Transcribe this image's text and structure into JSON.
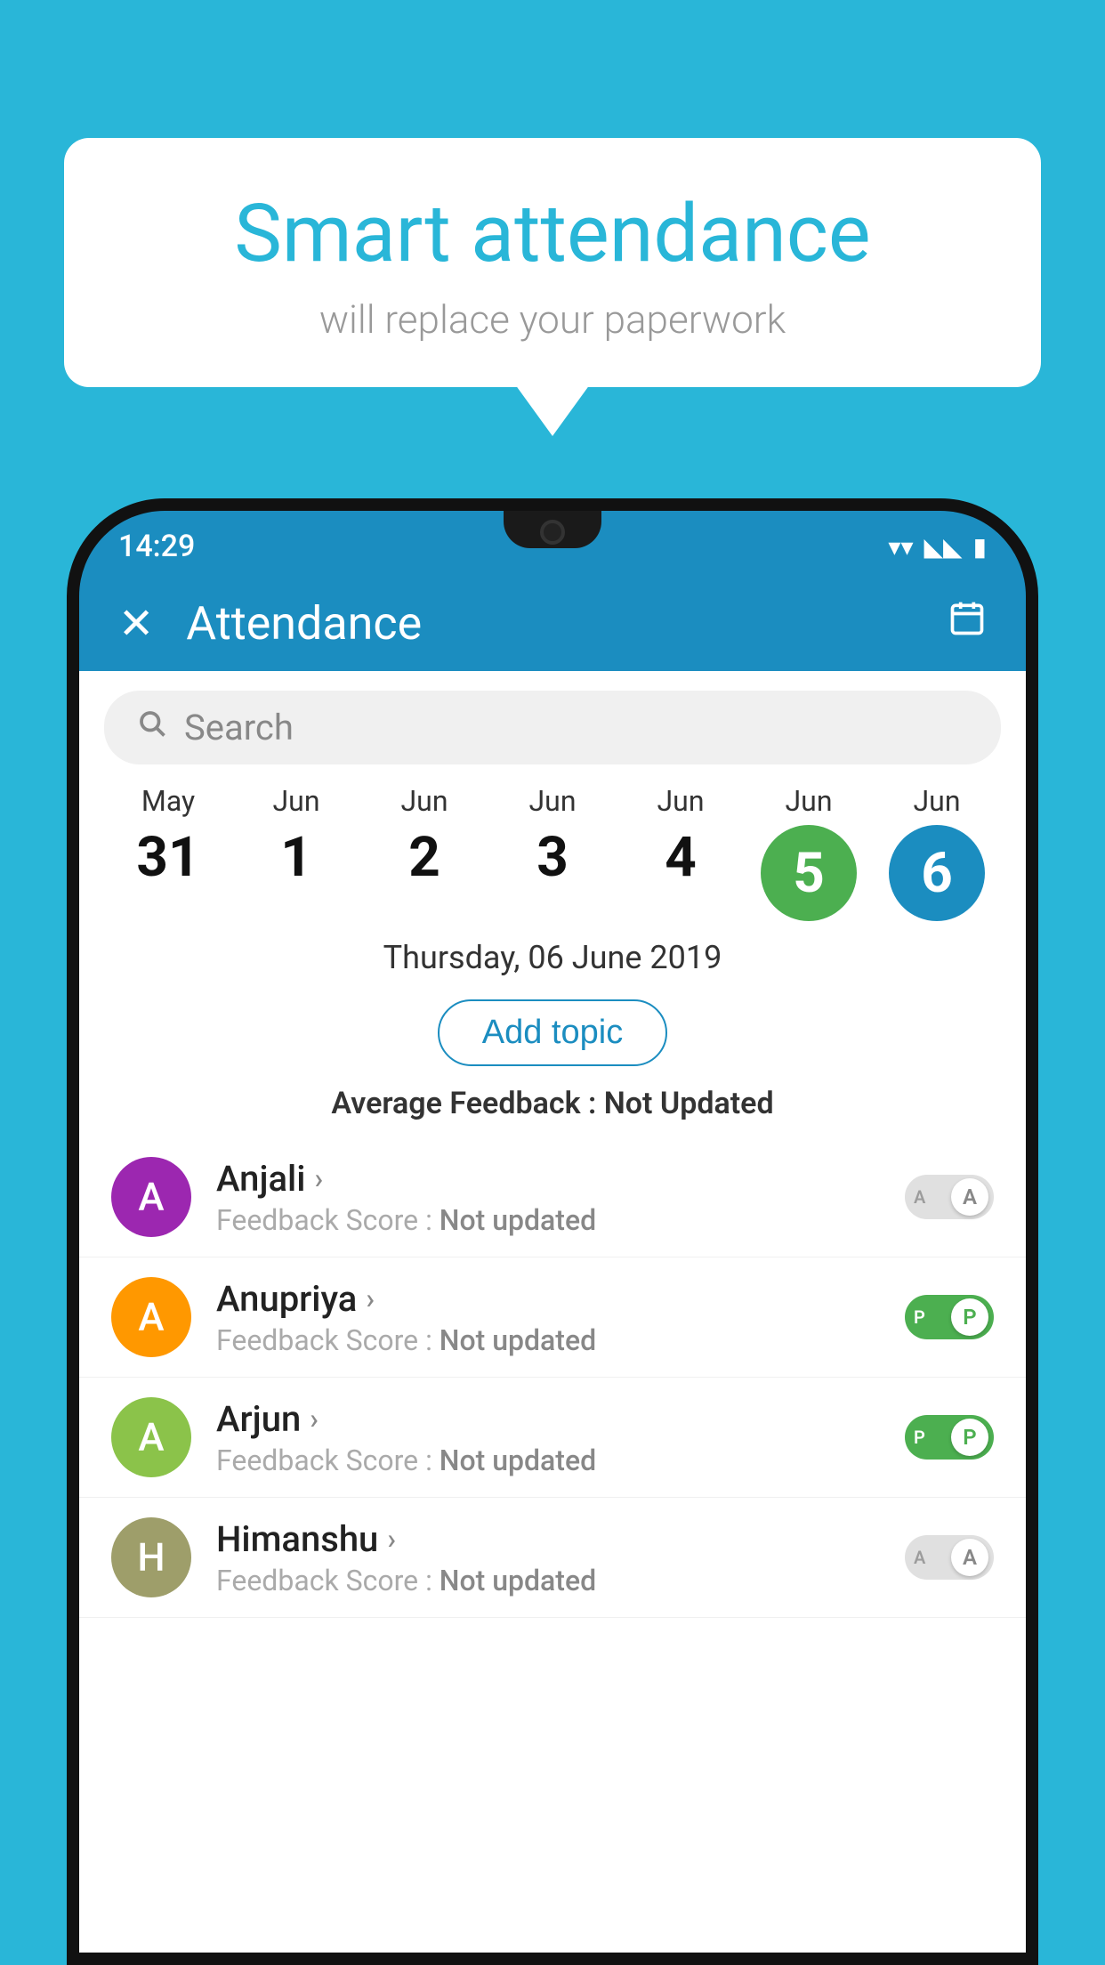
{
  "background_color": "#29B6D8",
  "bubble": {
    "title": "Smart attendance",
    "subtitle": "will replace your paperwork"
  },
  "status_bar": {
    "time": "14:29",
    "wifi": "▼",
    "signal": "◀",
    "battery": "▮"
  },
  "header": {
    "close_label": "✕",
    "title": "Attendance",
    "calendar_icon": "📅"
  },
  "search": {
    "placeholder": "Search"
  },
  "dates": [
    {
      "month": "May",
      "day": "31",
      "type": "plain"
    },
    {
      "month": "Jun",
      "day": "1",
      "type": "plain"
    },
    {
      "month": "Jun",
      "day": "2",
      "type": "plain"
    },
    {
      "month": "Jun",
      "day": "3",
      "type": "plain"
    },
    {
      "month": "Jun",
      "day": "4",
      "type": "plain"
    },
    {
      "month": "Jun",
      "day": "5",
      "type": "green"
    },
    {
      "month": "Jun",
      "day": "6",
      "type": "blue"
    }
  ],
  "selected_date": "Thursday, 06 June 2019",
  "add_topic_label": "Add topic",
  "avg_feedback_label": "Average Feedback : ",
  "avg_feedback_value": "Not Updated",
  "students": [
    {
      "name": "Anjali",
      "initial": "A",
      "avatar_color": "purple",
      "score_label": "Feedback Score : ",
      "score_value": "Not updated",
      "toggle": "off"
    },
    {
      "name": "Anupriya",
      "initial": "A",
      "avatar_color": "orange",
      "score_label": "Feedback Score : ",
      "score_value": "Not updated",
      "toggle": "on"
    },
    {
      "name": "Arjun",
      "initial": "A",
      "avatar_color": "lightgreen",
      "score_label": "Feedback Score : ",
      "score_value": "Not updated",
      "toggle": "on"
    },
    {
      "name": "Himanshu",
      "initial": "H",
      "avatar_color": "olive",
      "score_label": "Feedback Score : ",
      "score_value": "Not updated",
      "toggle": "off"
    }
  ]
}
